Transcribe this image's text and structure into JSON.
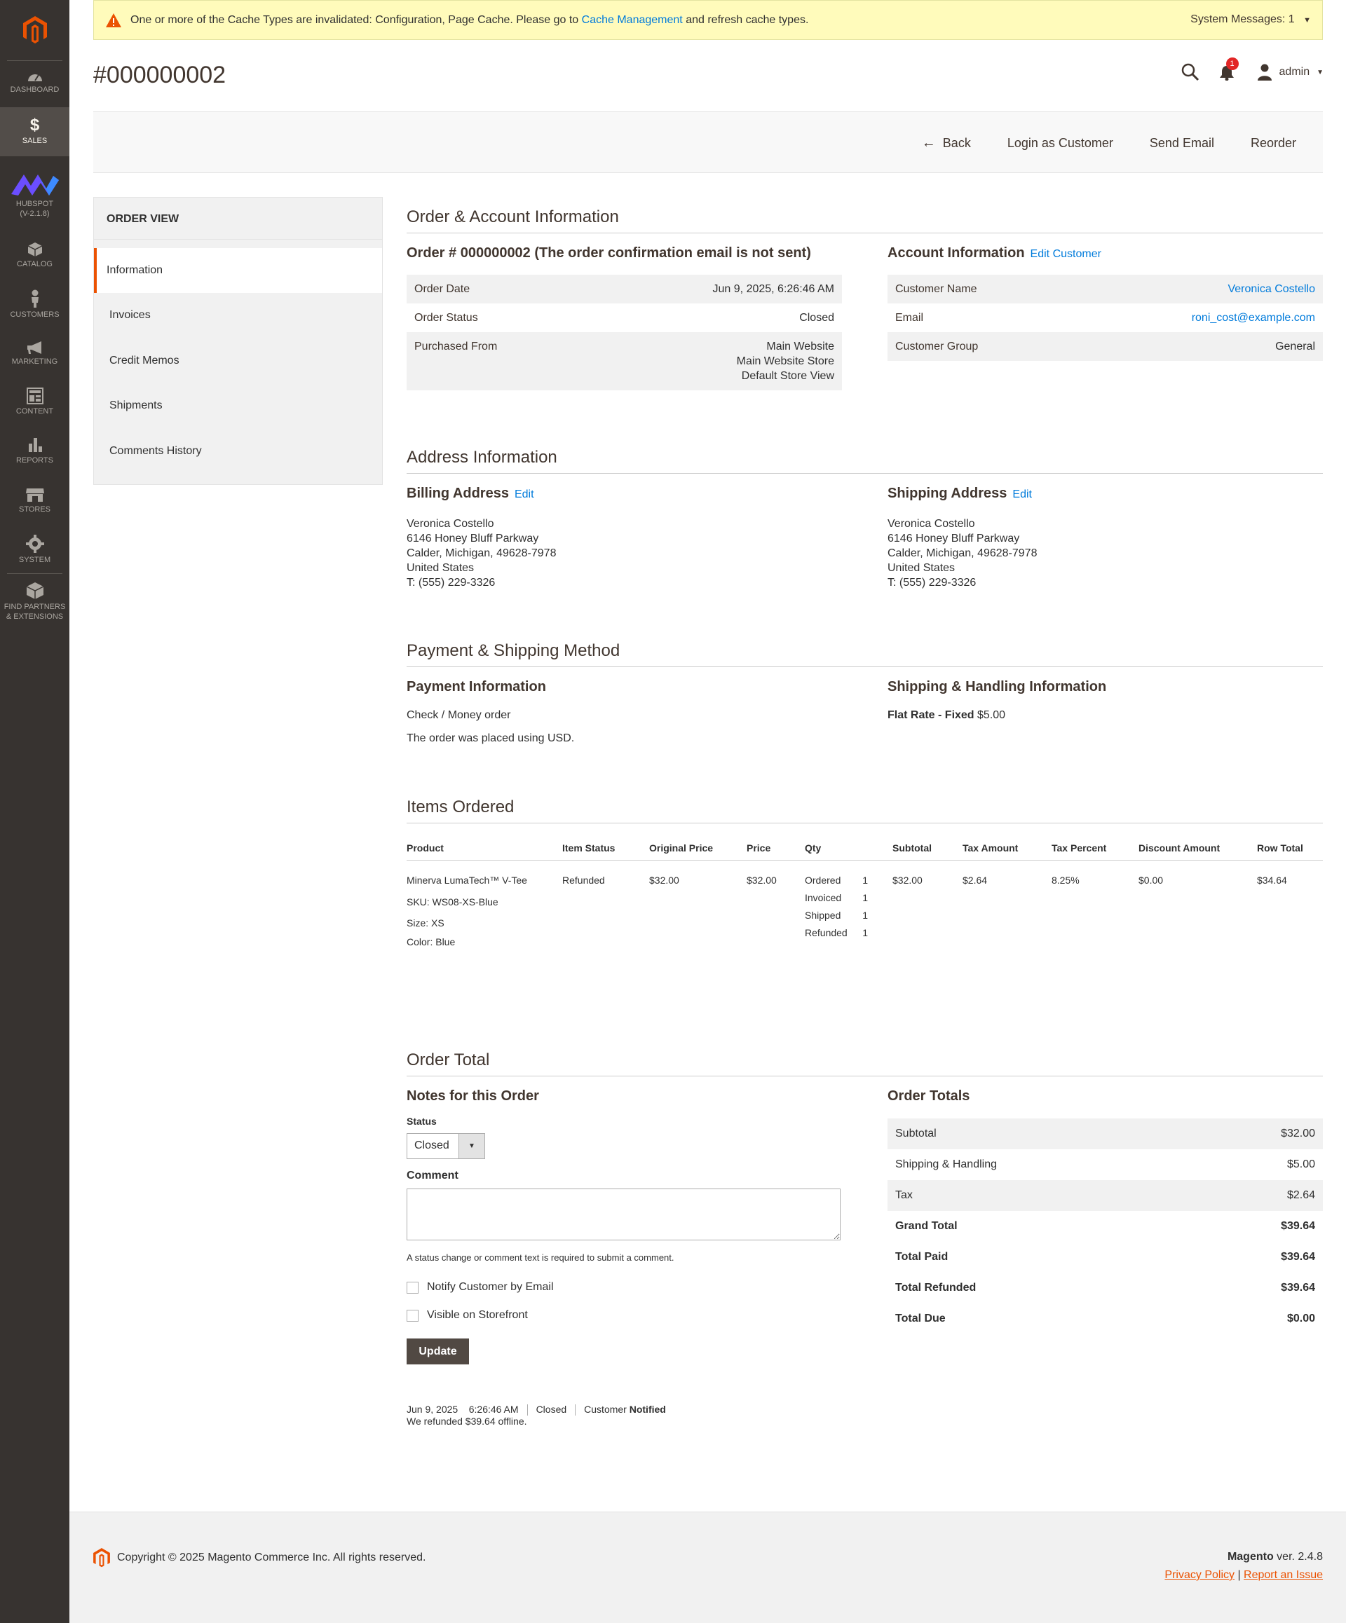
{
  "sidebar": {
    "items": [
      {
        "label": "DASHBOARD"
      },
      {
        "label": "SALES"
      },
      {
        "label1": "HUBSPOT",
        "label2": "(V-2.1.8)"
      },
      {
        "label": "CATALOG"
      },
      {
        "label": "CUSTOMERS"
      },
      {
        "label": "MARKETING"
      },
      {
        "label": "CONTENT"
      },
      {
        "label": "REPORTS"
      },
      {
        "label": "STORES"
      },
      {
        "label": "SYSTEM"
      },
      {
        "label1": "FIND PARTNERS",
        "label2": "& EXTENSIONS"
      }
    ]
  },
  "message": {
    "text_before": "One or more of the Cache Types are invalidated: Configuration, Page Cache. Please go to",
    "link": "Cache Management",
    "text_after": "and refresh cache types.",
    "system_messages": "System Messages: 1"
  },
  "header": {
    "title": "#000000002",
    "notification_count": "1",
    "user": "admin"
  },
  "actions": {
    "back": "Back",
    "login_as_customer": "Login as Customer",
    "send_email": "Send Email",
    "reorder": "Reorder"
  },
  "tabs": {
    "title": "ORDER VIEW",
    "items": [
      "Information",
      "Invoices",
      "Credit Memos",
      "Shipments",
      "Comments History"
    ]
  },
  "order_account": {
    "section_title": "Order & Account Information",
    "order_title": "Order # 000000002 (The order confirmation email is not sent)",
    "order_rows": [
      {
        "label": "Order Date",
        "value": "Jun 9, 2025, 6:26:46 AM"
      },
      {
        "label": "Order Status",
        "value": "Closed"
      },
      {
        "label": "Purchased From",
        "value1": "Main Website",
        "value2": "Main Website Store",
        "value3": "Default Store View"
      }
    ],
    "account_title": "Account Information",
    "edit_customer": "Edit Customer",
    "account_rows": [
      {
        "label": "Customer Name",
        "value": "Veronica Costello"
      },
      {
        "label": "Email",
        "value": "roni_cost@example.com"
      },
      {
        "label": "Customer Group",
        "value": "General"
      }
    ]
  },
  "address": {
    "section_title": "Address Information",
    "billing_title": "Billing Address",
    "shipping_title": "Shipping Address",
    "edit": "Edit",
    "lines": [
      "Veronica Costello",
      "6146 Honey Bluff Parkway",
      "Calder, Michigan, 49628-7978",
      "United States",
      "T: (555) 229-3326"
    ]
  },
  "payment": {
    "section_title": "Payment & Shipping Method",
    "payment_title": "Payment Information",
    "method": "Check / Money order",
    "currency_note": "The order was placed using USD.",
    "shipping_title": "Shipping & Handling Information",
    "shipping_method": "Flat Rate - Fixed",
    "shipping_price": "$5.00"
  },
  "items": {
    "section_title": "Items Ordered",
    "columns": [
      "Product",
      "Item Status",
      "Original Price",
      "Price",
      "Qty",
      "Subtotal",
      "Tax Amount",
      "Tax Percent",
      "Discount Amount",
      "Row Total"
    ],
    "row": {
      "product": "Minerva LumaTech™ V-Tee",
      "sku": "SKU: WS08-XS-Blue",
      "size": "Size:  XS",
      "color": "Color:  Blue",
      "status": "Refunded",
      "original_price": "$32.00",
      "price": "$32.00",
      "qty": [
        {
          "label": "Ordered",
          "value": "1"
        },
        {
          "label": "Invoiced",
          "value": "1"
        },
        {
          "label": "Shipped",
          "value": "1"
        },
        {
          "label": "Refunded",
          "value": "1"
        }
      ],
      "subtotal": "$32.00",
      "tax_amount": "$2.64",
      "tax_percent": "8.25%",
      "discount": "$0.00",
      "row_total": "$34.64"
    }
  },
  "order_total": {
    "section_title": "Order Total",
    "notes_title": "Notes for this Order",
    "status_label": "Status",
    "status_value": "Closed",
    "comment_label": "Comment",
    "comment_note": "A status change or comment text is required to submit a comment.",
    "notify_label": "Notify Customer by Email",
    "visible_label": "Visible on Storefront",
    "update_button": "Update",
    "totals_title": "Order Totals",
    "totals": [
      {
        "label": "Subtotal",
        "value": "$32.00"
      },
      {
        "label": "Shipping & Handling",
        "value": "$5.00"
      },
      {
        "label": "Tax",
        "value": "$2.64"
      },
      {
        "label": "Grand Total",
        "value": "$39.64"
      },
      {
        "label": "Total Paid",
        "value": "$39.64"
      },
      {
        "label": "Total Refunded",
        "value": "$39.64"
      },
      {
        "label": "Total Due",
        "value": "$0.00"
      }
    ],
    "history": {
      "date": "Jun 9, 2025",
      "time": "6:26:46 AM",
      "status": "Closed",
      "customer_label": "Customer",
      "notified": "Notified",
      "comment": "We refunded $39.64 offline."
    }
  },
  "footer": {
    "copyright": "Copyright © 2025 Magento Commerce Inc. All rights reserved.",
    "brand": "Magento",
    "version": "ver. 2.4.8",
    "privacy": "Privacy Policy",
    "report": "Report an Issue"
  },
  "colors": {
    "accent": "#eb5202",
    "link": "#007bdb",
    "sidebar": "#373330"
  }
}
